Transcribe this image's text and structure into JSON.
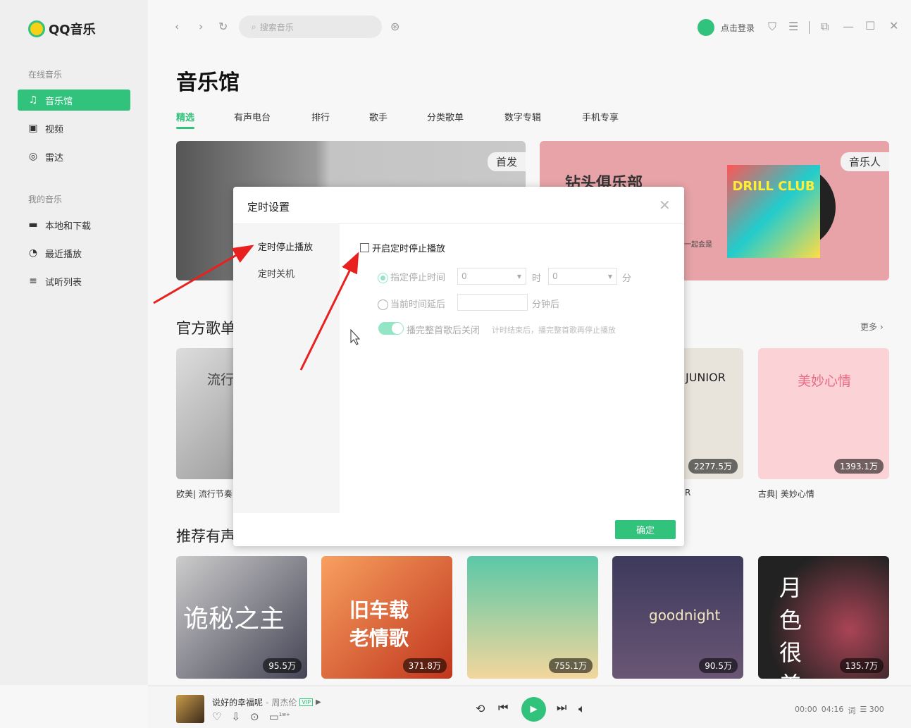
{
  "app": {
    "name": "QQ音乐"
  },
  "sidebar": {
    "groups": [
      {
        "label": "在线音乐",
        "items": [
          {
            "label": "音乐馆",
            "icon": "music-note-icon",
            "active": true
          },
          {
            "label": "视频",
            "icon": "video-icon"
          },
          {
            "label": "雷达",
            "icon": "radar-icon"
          }
        ]
      },
      {
        "label": "我的音乐",
        "items": [
          {
            "label": "本地和下载",
            "icon": "monitor-icon"
          },
          {
            "label": "最近播放",
            "icon": "clock-icon"
          },
          {
            "label": "试听列表",
            "icon": "playlist-icon"
          }
        ]
      }
    ]
  },
  "toolbar": {
    "search_placeholder": "搜索音乐",
    "login": "点击登录"
  },
  "main": {
    "title": "音乐馆",
    "tabs": [
      "精选",
      "有声电台",
      "排行",
      "歌手",
      "分类歌单",
      "数字专辑",
      "手机专享"
    ],
    "banners": [
      {
        "badge": "首发"
      },
      {
        "badge": "音乐人",
        "title": "钻头俱乐部",
        "subtitle": "一起会是",
        "album": "DRILL CLUB"
      }
    ],
    "official": {
      "title": "官方歌单",
      "more": "更多",
      "cards": [
        {
          "text": "流行",
          "count": "",
          "label": "欧美| 流行节奏"
        },
        {
          "count": ""
        },
        {
          "count": ""
        },
        {
          "text": "JUNIOR",
          "count": "2277.5万",
          "label": "R"
        },
        {
          "text": "美妙心情",
          "count": "1393.1万",
          "label": "古典| 美妙心情"
        }
      ]
    },
    "audio": {
      "title": "推荐有声",
      "cards": [
        {
          "text": "诡秘之主",
          "count": "95.5万"
        },
        {
          "text": "旧车载老情歌",
          "count": "371.8万"
        },
        {
          "count": "755.1万"
        },
        {
          "text": "goodnight",
          "count": "90.5万"
        },
        {
          "text": "月色很美",
          "count": "135.7万"
        }
      ]
    }
  },
  "dialog": {
    "title": "定时设置",
    "menu": [
      "定时停止播放",
      "定时关机"
    ],
    "enable_label": "开启定时停止播放",
    "enabled": false,
    "option1": "指定停止时间",
    "hour_value": "0",
    "hour_unit": "时",
    "minute_value": "0",
    "minute_unit": "分",
    "option2": "当前时间延后",
    "delay_value": "",
    "delay_unit": "分钟后",
    "toggle_label": "播完整首歌后关闭",
    "toggle_on": true,
    "toggle_hint": "计时结束后，播完整首歌再停止播放",
    "confirm": "确定"
  },
  "player": {
    "song": "说好的幸福呢",
    "artist": "周杰伦",
    "vip": "VIP",
    "comments": "1w+",
    "time_current": "00:00",
    "time_total": "04:16",
    "lyric": "词",
    "count": "300"
  },
  "colors": {
    "accent": "#31c27c",
    "annotation": "#e8201e"
  }
}
